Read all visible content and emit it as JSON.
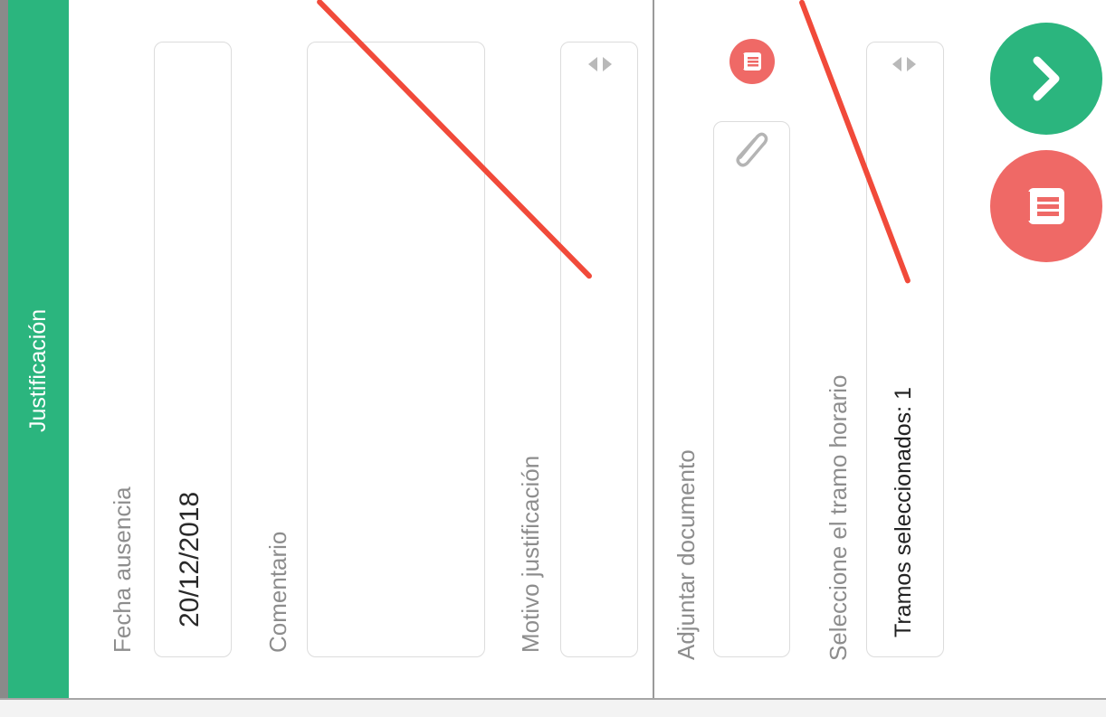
{
  "header": {
    "title": "Justificación"
  },
  "form": {
    "fecha_label": "Fecha ausencia",
    "fecha_value": "20/12/2018",
    "comentario_label": "Comentario",
    "comentario_value": "",
    "motivo_label": "Motivo justificación",
    "motivo_value": "",
    "adjuntar_label": "Adjuntar documento",
    "tramo_label": "Seleccione el tramo horario",
    "tramo_value": "Tramos seleccionados: 1"
  },
  "icons": {
    "select_arrows": "select-arrows-icon",
    "clear": "list-icon",
    "attach": "paperclip-icon",
    "next": "chevron-right-icon"
  },
  "colors": {
    "header": "#2bb57e",
    "accent_red": "#ef6966",
    "annotation": "#f14a3a"
  }
}
